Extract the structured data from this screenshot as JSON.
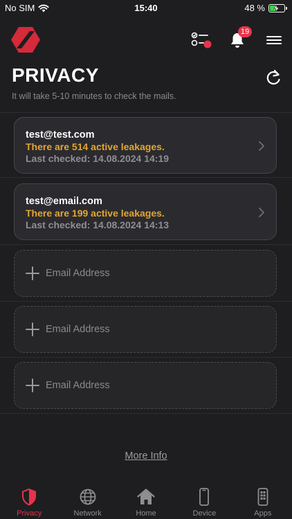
{
  "status_bar": {
    "carrier": "No SIM",
    "time": "15:40",
    "battery_percent": "48 %",
    "battery_level": 0.48
  },
  "header": {
    "notification_count": "19"
  },
  "page": {
    "title": "PRIVACY",
    "subtitle": "It will take 5-10 minutes to check the mails."
  },
  "emails": [
    {
      "email": "test@test.com",
      "leaks": "There are 514 active leakages.",
      "last_checked": "Last checked: 14.08.2024 14:19"
    },
    {
      "email": "test@email.com",
      "leaks": "There are 199 active leakages.",
      "last_checked": "Last checked: 14.08.2024 14:13"
    }
  ],
  "add_slots": [
    {
      "placeholder": "Email Address"
    },
    {
      "placeholder": "Email Address"
    },
    {
      "placeholder": "Email Address"
    }
  ],
  "more_info": "More Info",
  "tabs": [
    {
      "label": "Privacy",
      "icon": "shield-icon",
      "active": true
    },
    {
      "label": "Network",
      "icon": "globe-icon",
      "active": false
    },
    {
      "label": "Home",
      "icon": "home-icon",
      "active": false
    },
    {
      "label": "Device",
      "icon": "phone-icon",
      "active": false
    },
    {
      "label": "Apps",
      "icon": "apps-icon",
      "active": false
    }
  ],
  "colors": {
    "accent": "#e8334a",
    "warning": "#e3a631",
    "background": "#1e1e21",
    "card": "#2b2b2f"
  }
}
